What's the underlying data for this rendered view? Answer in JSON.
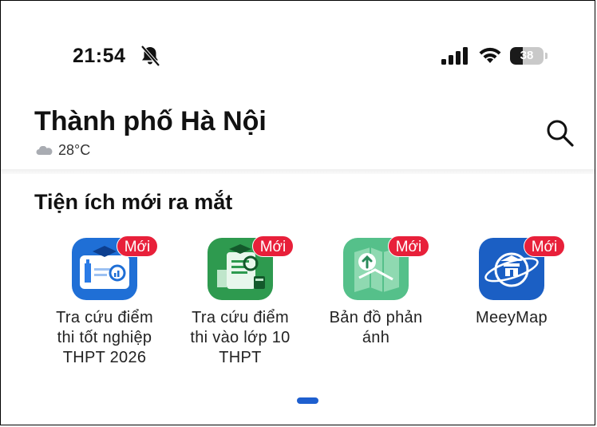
{
  "status_bar": {
    "time": "21:54",
    "battery_level": "38",
    "battery_fraction": 0.38,
    "icons": [
      "bell-slash-icon",
      "cellular-signal-icon",
      "wifi-icon",
      "battery-icon"
    ]
  },
  "header": {
    "city": "Thành phố Hà Nội",
    "temperature": "28°C",
    "weather_icon": "cloud-icon",
    "search_icon": "search-icon"
  },
  "section": {
    "title": "Tiện ích mới ra mắt"
  },
  "utilities": [
    {
      "label_lines": [
        "Tra cứu điểm",
        "thi tốt nghiệp",
        "THPT 2026"
      ],
      "badge": "Mới",
      "icon": "exam-results-icon",
      "color": "#1f6fd6"
    },
    {
      "label_lines": [
        "Tra cứu điểm",
        "thi vào lớp 10",
        "THPT"
      ],
      "badge": "Mới",
      "icon": "grade10-results-icon",
      "color": "#2e9a4f"
    },
    {
      "label_lines": [
        "Bản đồ phản",
        "ánh"
      ],
      "badge": "Mới",
      "icon": "feedback-map-icon",
      "color": "#55c08a"
    },
    {
      "label_lines": [
        "MeeyMap"
      ],
      "badge": "Mới",
      "icon": "meeymap-icon",
      "color": "#1b5fc4"
    }
  ],
  "colors": {
    "badge": "#e8203a",
    "pager_dot": "#1e5fcf"
  },
  "pager": {
    "active_index": 0
  }
}
